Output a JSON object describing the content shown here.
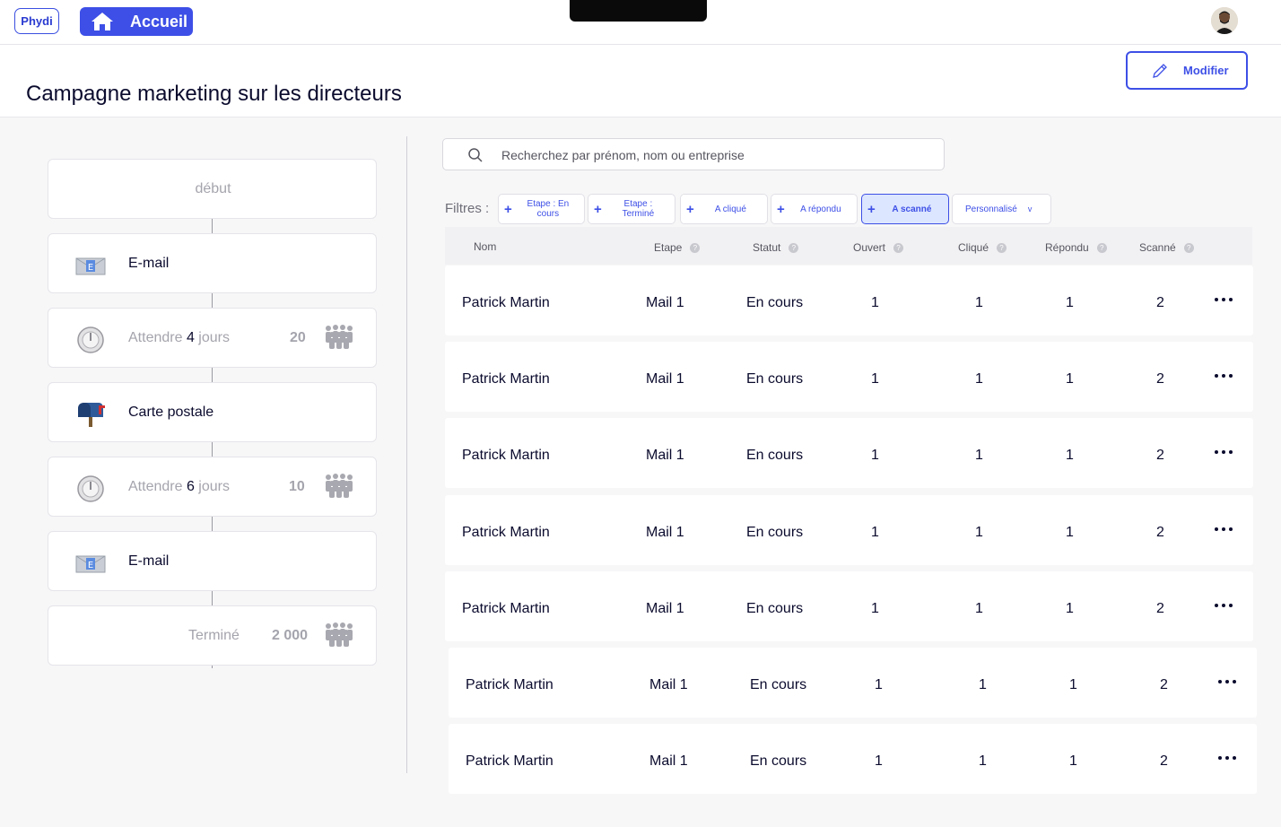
{
  "topbar": {
    "logo": "Phydi",
    "home_label": "Accueil"
  },
  "page": {
    "title": "Campagne marketing sur les directeurs",
    "modify_label": "Modifier"
  },
  "flow": {
    "start": "début",
    "email1": "E-mail",
    "wait1": {
      "prefix": "Attendre ",
      "days": "4",
      "suffix": " jours",
      "count": "20"
    },
    "postcard": "Carte postale",
    "wait2": {
      "prefix": "Attendre ",
      "days": "6",
      "suffix": " jours",
      "count": "10"
    },
    "email2": "E-mail",
    "end": {
      "label": "Terminé",
      "count": "2 000"
    }
  },
  "search": {
    "placeholder": "Recherchez par prénom, nom ou entreprise"
  },
  "filters": {
    "label": "Filtres :",
    "chips": [
      "Etape : En cours",
      "Etape : Terminé",
      "A cliqué",
      "A répondu",
      "A scanné",
      "Personnalisé"
    ],
    "dropdown_indicator": "v"
  },
  "table": {
    "headers": [
      "Nom",
      "Etape",
      "Statut",
      "Ouvert",
      "Cliqué",
      "Répondu",
      "Scanné"
    ],
    "rows": [
      {
        "name": "Patrick Martin",
        "etape": "Mail 1",
        "statut": "En cours",
        "ouvert": "1",
        "clique": "1",
        "repondu": "1",
        "scanne": "2"
      },
      {
        "name": "Patrick Martin",
        "etape": "Mail 1",
        "statut": "En cours",
        "ouvert": "1",
        "clique": "1",
        "repondu": "1",
        "scanne": "2"
      },
      {
        "name": "Patrick Martin",
        "etape": "Mail 1",
        "statut": "En cours",
        "ouvert": "1",
        "clique": "1",
        "repondu": "1",
        "scanne": "2"
      },
      {
        "name": "Patrick Martin",
        "etape": "Mail 1",
        "statut": "En cours",
        "ouvert": "1",
        "clique": "1",
        "repondu": "1",
        "scanne": "2"
      },
      {
        "name": "Patrick Martin",
        "etape": "Mail 1",
        "statut": "En cours",
        "ouvert": "1",
        "clique": "1",
        "repondu": "1",
        "scanne": "2"
      },
      {
        "name": "Patrick Martin",
        "etape": "Mail 1",
        "statut": "En cours",
        "ouvert": "1",
        "clique": "1",
        "repondu": "1",
        "scanne": "2"
      },
      {
        "name": "Patrick Martin",
        "etape": "Mail 1",
        "statut": "En cours",
        "ouvert": "1",
        "clique": "1",
        "repondu": "1",
        "scanne": "2"
      }
    ]
  },
  "colors": {
    "accent": "#3d4fe6",
    "text": "#0b0b2e",
    "muted": "#a4a4ad",
    "chip_active_bg": "#dce6ff"
  },
  "icons": [
    "home-icon",
    "pencil-icon",
    "search-icon",
    "email-icon",
    "timer-icon",
    "mailbox-icon",
    "people-icon",
    "more-icon",
    "help-icon"
  ]
}
